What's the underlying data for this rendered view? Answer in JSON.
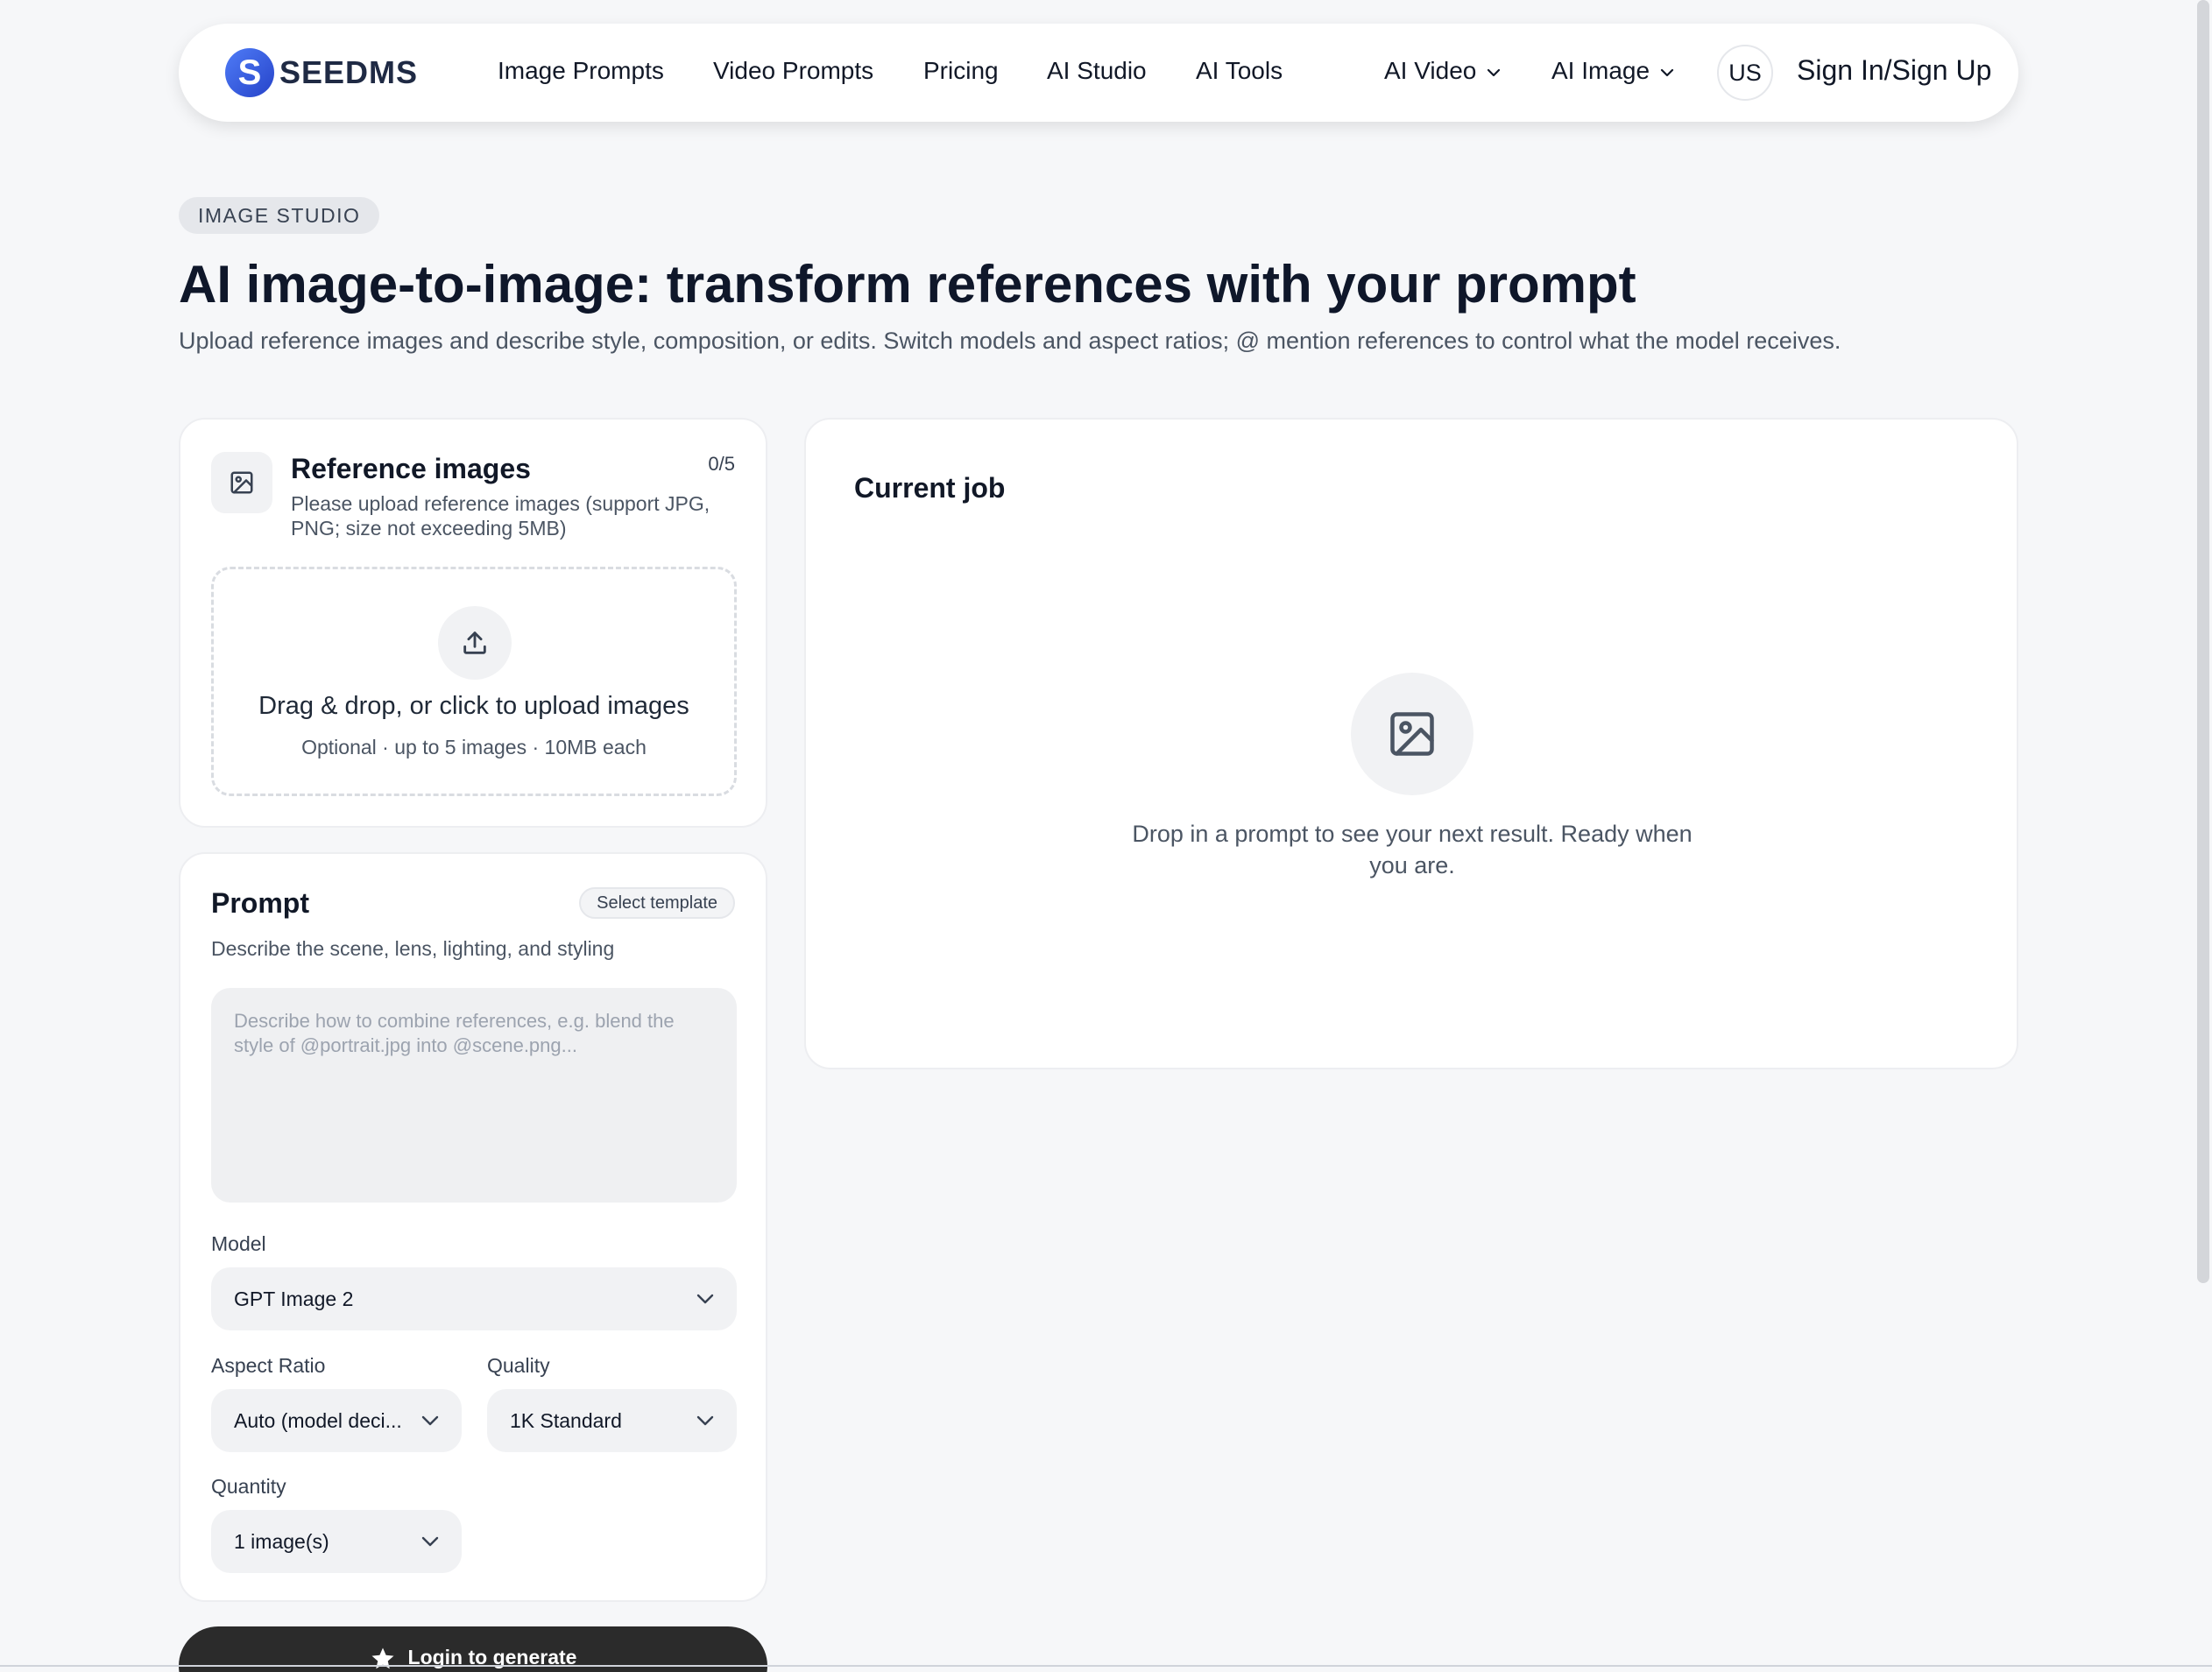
{
  "nav": {
    "logo_letter": "S",
    "logo_text": "SEEDMS",
    "links": [
      "Image Prompts",
      "Video Prompts",
      "Pricing",
      "AI Studio",
      "AI Tools"
    ],
    "dropdowns": [
      "AI Video",
      "AI Image"
    ],
    "lang": "US",
    "signin": "Sign In/Sign Up"
  },
  "hero": {
    "badge": "IMAGE STUDIO",
    "title": "AI image-to-image: transform references with your prompt",
    "subtitle": "Upload reference images and describe style, composition, or edits. Switch models and aspect ratios; @ mention references to control what the model receives."
  },
  "reference": {
    "title": "Reference images",
    "count": "0/5",
    "description": "Please upload reference images (support JPG, PNG; size not exceeding 5MB)",
    "dropzone_title": "Drag & drop, or click to upload images",
    "dropzone_sub": "Optional · up to 5 images · 10MB each"
  },
  "prompt": {
    "title": "Prompt",
    "template_button": "Select template",
    "description": "Describe the scene, lens, lighting, and styling",
    "value": "",
    "placeholder": "Describe how to combine references, e.g. blend the style of @portrait.jpg into @scene.png...",
    "model_label": "Model",
    "model_value": "GPT Image 2",
    "aspect_label": "Aspect Ratio",
    "aspect_value": "Auto (model deci...",
    "quality_label": "Quality",
    "quality_value": "1K Standard",
    "quantity_label": "Quantity",
    "quantity_value": "1 image(s)",
    "generate_button": "Login to generate"
  },
  "job": {
    "title": "Current job",
    "empty_text": "Drop in a prompt to see your next result. Ready when you are."
  },
  "icons": {
    "image": "image-icon",
    "upload": "upload-icon",
    "chevron": "chevron-down-icon",
    "star": "star-icon"
  }
}
